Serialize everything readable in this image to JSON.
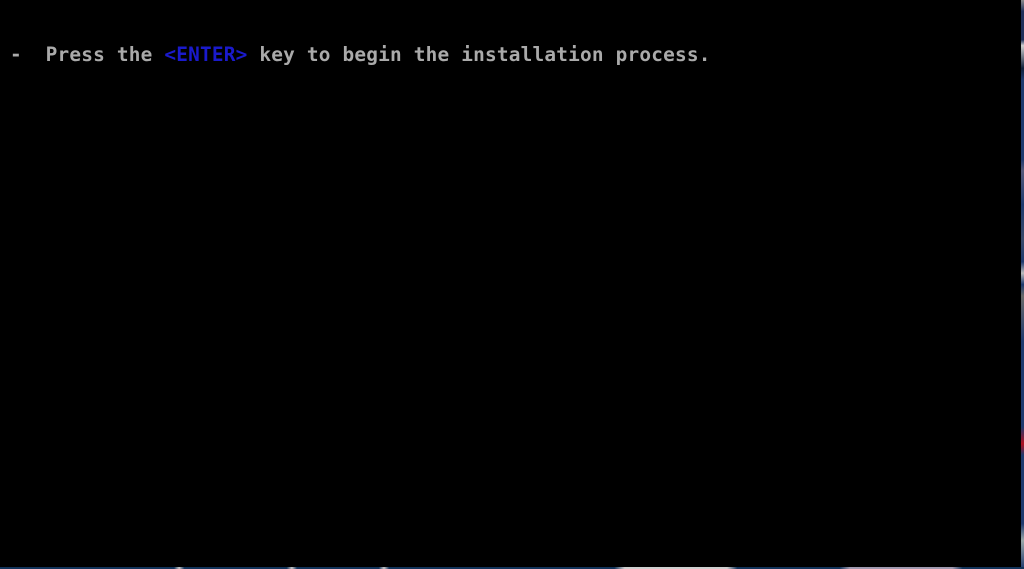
{
  "console": {
    "bullet": "-  ",
    "prefix": "Press the ",
    "key": "<ENTER>",
    "suffix": " key to begin the installation process."
  },
  "colors": {
    "background": "#000000",
    "text": "#aaaaaa",
    "key_highlight": "#1a1acc"
  }
}
